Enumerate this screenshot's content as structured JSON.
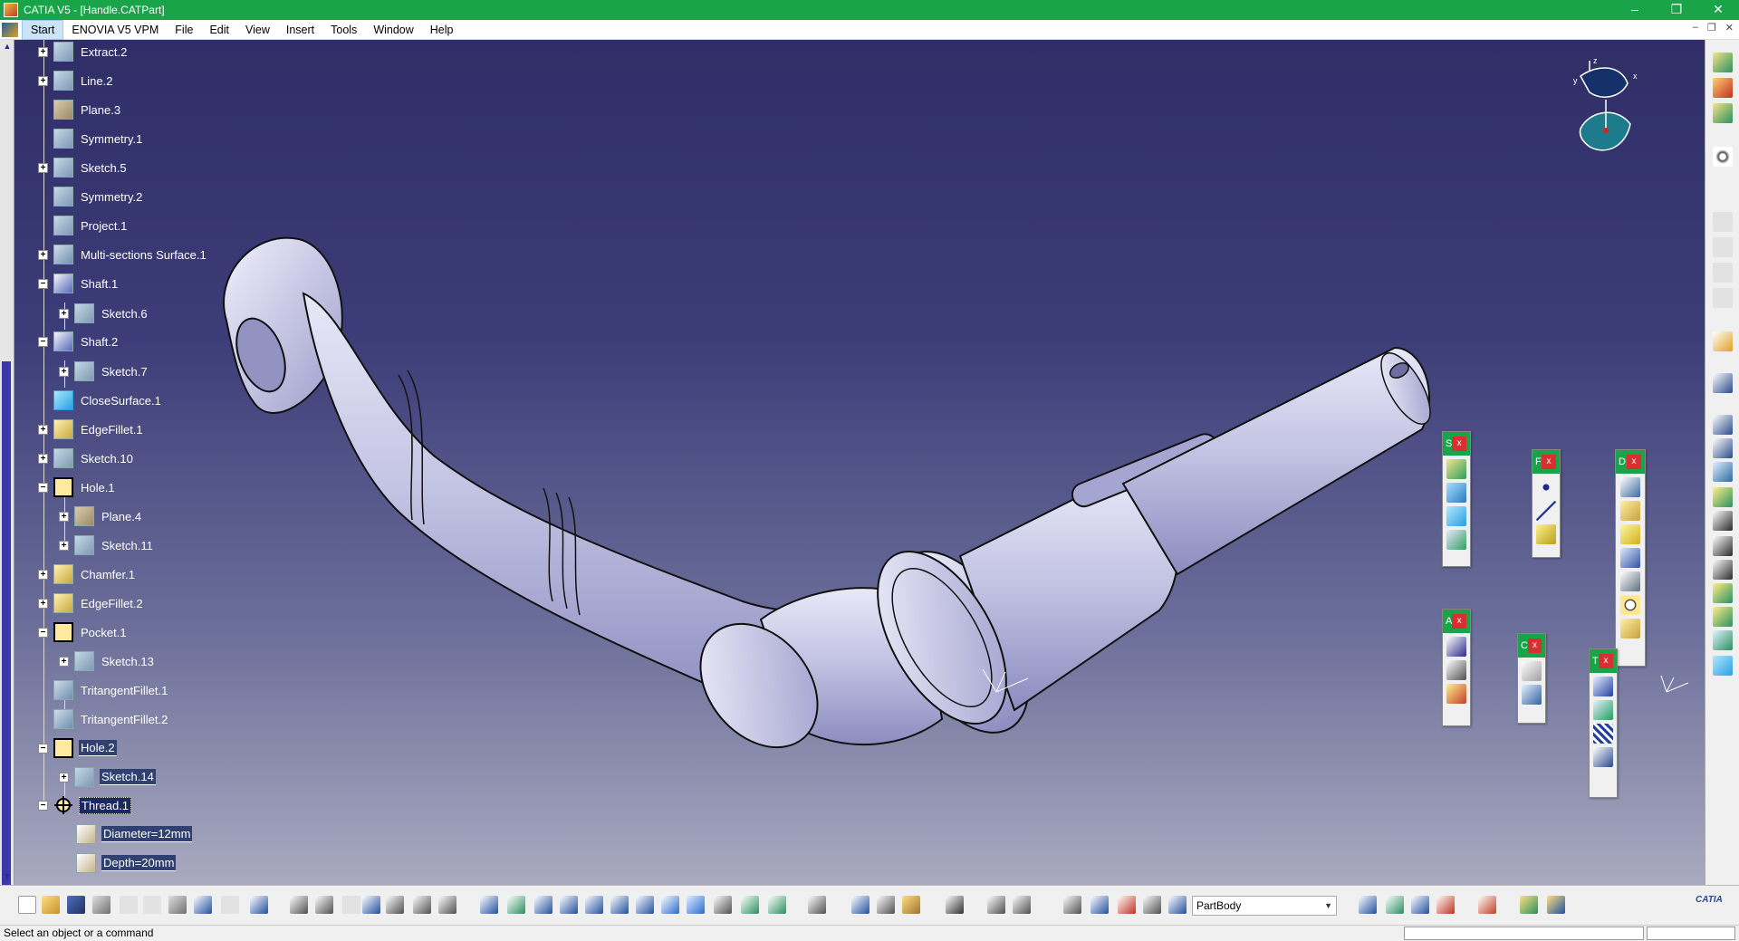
{
  "window": {
    "title": "CATIA V5 - [Handle.CATPart]",
    "controls": [
      "–",
      "❐",
      "✕"
    ]
  },
  "menu": {
    "items": [
      "Start",
      "ENOVIA V5 VPM",
      "File",
      "Edit",
      "View",
      "Insert",
      "Tools",
      "Window",
      "Help"
    ],
    "mdi_controls": [
      "–",
      "❐",
      "✕"
    ]
  },
  "tree": {
    "nodes": [
      {
        "label": "Extract.2",
        "icon": "sketch"
      },
      {
        "label": "Line.2",
        "icon": "sketch"
      },
      {
        "label": "Plane.3",
        "icon": "plane"
      },
      {
        "label": "Symmetry.1",
        "icon": "sketch"
      },
      {
        "label": "Sketch.5",
        "icon": "sketch"
      },
      {
        "label": "Symmetry.2",
        "icon": "sketch"
      },
      {
        "label": "Project.1",
        "icon": "sketch"
      },
      {
        "label": "Multi-sections Surface.1",
        "icon": "surf"
      },
      {
        "label": "Shaft.1",
        "icon": "shaft"
      },
      {
        "label": "Sketch.6",
        "icon": "sketch"
      },
      {
        "label": "Shaft.2",
        "icon": "shaft"
      },
      {
        "label": "Sketch.7",
        "icon": "sketch"
      },
      {
        "label": "CloseSurface.1",
        "icon": "closesurf"
      },
      {
        "label": "EdgeFillet.1",
        "icon": "fillet"
      },
      {
        "label": "Sketch.10",
        "icon": "sketch"
      },
      {
        "label": "Hole.1",
        "icon": "hole"
      },
      {
        "label": "Plane.4",
        "icon": "plane"
      },
      {
        "label": "Sketch.11",
        "icon": "sketch"
      },
      {
        "label": "Chamfer.1",
        "icon": "fillet"
      },
      {
        "label": "EdgeFillet.2",
        "icon": "fillet"
      },
      {
        "label": "Pocket.1",
        "icon": "hole"
      },
      {
        "label": "Sketch.13",
        "icon": "sketch"
      },
      {
        "label": "TritangentFillet.1",
        "icon": "surf"
      },
      {
        "label": "TritangentFillet.2",
        "icon": "surf"
      },
      {
        "label": "Hole.2",
        "icon": "hole"
      },
      {
        "label": "Sketch.14",
        "icon": "sketch"
      },
      {
        "label": "Thread.1",
        "icon": "thread"
      },
      {
        "label": "Diameter=12mm",
        "icon": "param"
      },
      {
        "label": "Depth=20mm",
        "icon": "param"
      }
    ]
  },
  "compass_labels": {
    "z": "z",
    "x": "x",
    "y": "y"
  },
  "floating_toolbars": [
    {
      "letter": "S",
      "close": "x"
    },
    {
      "letter": "F",
      "close": "x"
    },
    {
      "letter": "D",
      "close": "x"
    },
    {
      "letter": "A",
      "close": "x"
    },
    {
      "letter": "C",
      "close": "x"
    },
    {
      "letter": "T",
      "close": "x"
    }
  ],
  "bottom_toolbar": {
    "body_select_value": "PartBody",
    "logo": "CATIA"
  },
  "status": {
    "message": "Select an object or a command"
  }
}
